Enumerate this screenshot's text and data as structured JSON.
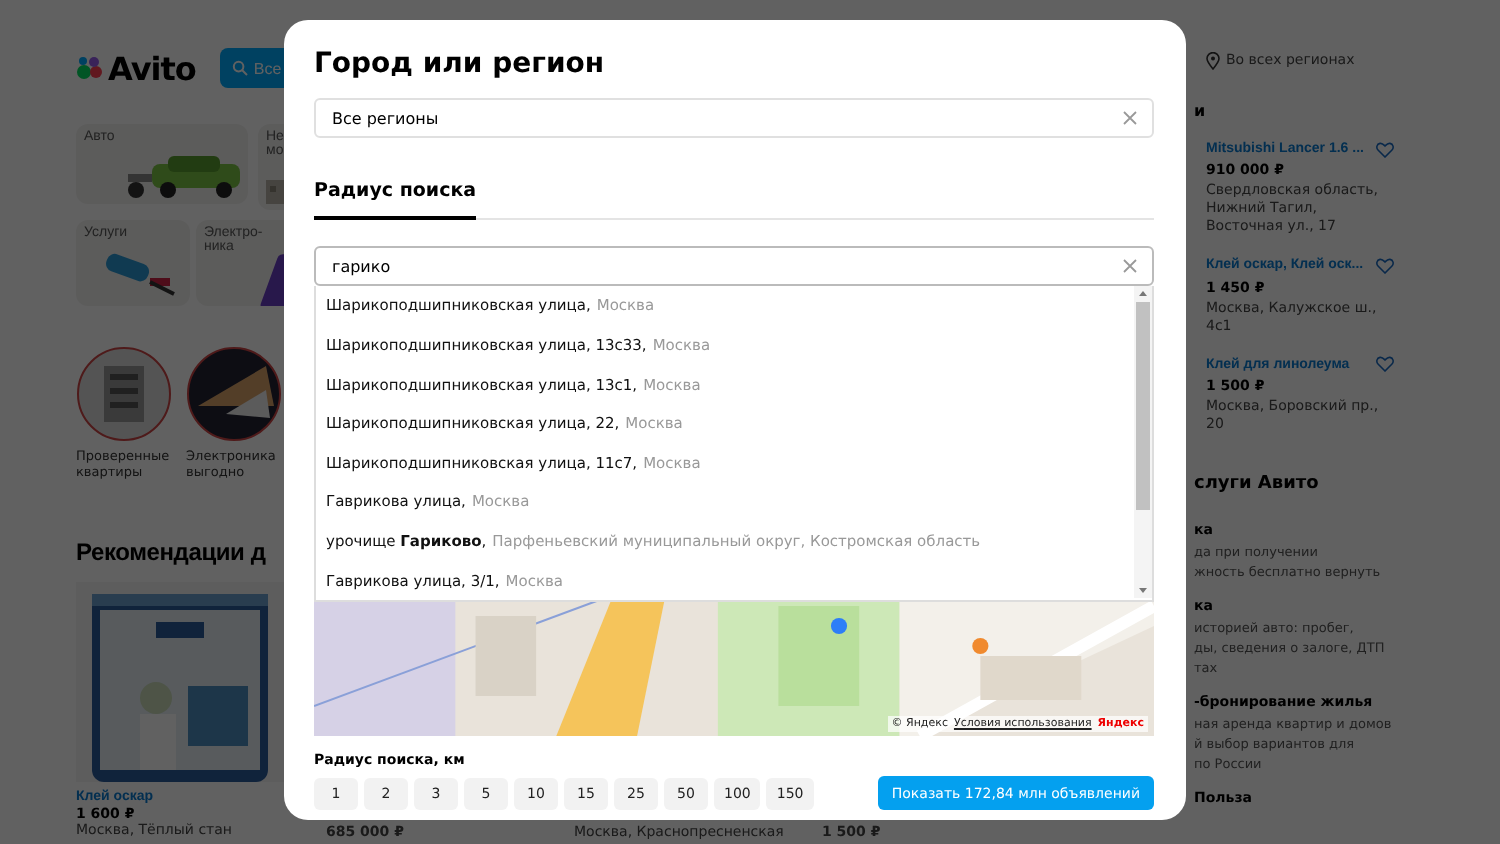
{
  "background": {
    "logo": "Avito",
    "catalog_button": "Все",
    "location": "Во всех регионах",
    "categories": [
      {
        "label": "Авто",
        "kind": "wide"
      },
      {
        "label": "Не мо",
        "kind": "cut"
      },
      {
        "label": "Услуги",
        "kind": "half"
      },
      {
        "label": "Электро-ника",
        "kind": "half"
      }
    ],
    "stories": [
      {
        "label": "Проверенные квартиры"
      },
      {
        "label": "Электроника выгодно"
      }
    ],
    "recommendations_title": "Рекомендации д",
    "product": {
      "title": "Клей оскар",
      "price": "1 600 ₽",
      "address": "Москва, Тёплый стан"
    },
    "bottom_row": [
      "685 000 ₽",
      "Москва, Краснопресненская",
      "1 500 ₽"
    ],
    "side_heading": "и",
    "side_items": [
      {
        "title": "Mitsubishi Lancer 1.6 ...",
        "price": "910 000 ₽",
        "address": "Свердловская область, Нижний Тагил, Восточная ул., 17"
      },
      {
        "title": "Клей оскар, Клей оск...",
        "price": "1 450 ₽",
        "address": "Москва, Калужское ш., 4с1"
      },
      {
        "title": "Клей для линолеума",
        "price": "1 500 ₽",
        "address": "Москва, Боровский пр., 20"
      }
    ],
    "services_heading": "слуги Авито",
    "services": [
      {
        "title": "ка",
        "lines": [
          "да при получении",
          "жность бесплатно вернуть"
        ]
      },
      {
        "title": "ка",
        "lines": [
          "историей авто: пробег,",
          "ды, сведения о залоге, ДТП",
          "тах"
        ]
      },
      {
        "title": "-бронирование жилья",
        "lines": [
          "ная аренда квартир и домов",
          "й выбор вариантов для",
          "по России"
        ]
      },
      {
        "title": "Польза"
      }
    ]
  },
  "modal": {
    "title": "Город или регион",
    "region_field": {
      "value": "Все регионы"
    },
    "tabs": [
      {
        "label": "Радиус поиска",
        "selected": true
      }
    ],
    "search_field": {
      "value": "гарико"
    },
    "suggestions": [
      {
        "main": "Шарикоподшипниковская улица,",
        "detail": "Москва"
      },
      {
        "main": "Шарикоподшипниковская улица, 13с33,",
        "detail": "Москва"
      },
      {
        "main": "Шарикоподшипниковская улица, 13с1,",
        "detail": "Москва"
      },
      {
        "main": "Шарикоподшипниковская улица, 22,",
        "detail": "Москва"
      },
      {
        "main": "Шарикоподшипниковская улица, 11с7,",
        "detail": "Москва"
      },
      {
        "main": "Гаврикова улица,",
        "detail": "Москва"
      },
      {
        "main": "урочище **Гариково**,",
        "detail": "Парфеньевский муниципальный округ, Костромская область"
      },
      {
        "main": "Гаврикова улица, 3/1,",
        "detail": "Москва"
      }
    ],
    "map": {
      "kind": "picture",
      "copyright": "© Яндекс",
      "terms_link": "Условия использования",
      "brand": "Яндекс"
    },
    "radius_label": "Радиус поиска, км",
    "radius_options": [
      {
        "label": "1",
        "selected": false
      },
      {
        "label": "2",
        "selected": false
      },
      {
        "label": "3",
        "selected": false
      },
      {
        "label": "5",
        "selected": false
      },
      {
        "label": "10",
        "selected": false
      },
      {
        "label": "15",
        "selected": false
      },
      {
        "label": "25",
        "selected": false
      },
      {
        "label": "50",
        "selected": false
      },
      {
        "label": "100",
        "selected": false
      },
      {
        "label": "150",
        "selected": false
      }
    ],
    "show_button": "Показать 172,84 млн объявлений"
  }
}
